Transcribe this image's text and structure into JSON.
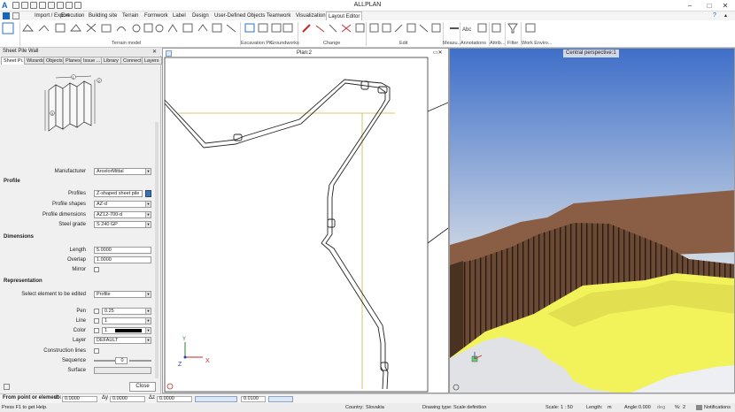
{
  "app": {
    "title": "ALLPLAN",
    "logo_letter": "A"
  },
  "window_controls": {
    "minimize": "–",
    "maximize": "□",
    "close": "✕"
  },
  "menu_tabs": [
    "Import / Export",
    "Execution",
    "Building site",
    "Terrain",
    "Formwork",
    "Label",
    "Design",
    "User-Defined Objects",
    "Teamwork",
    "Visualization",
    "Layout Editor"
  ],
  "menu_active": "Layout Editor",
  "ribbon_groups": [
    "Terrain model",
    "Excavation Pit",
    "Groundworks",
    "Change",
    "Edit",
    "Measu...",
    "Annotations",
    "Attrib...",
    "Filter",
    "Work Enviro..."
  ],
  "palette": {
    "title": "Sheet Pile Wall",
    "tabs": [
      "Sheet Pi...",
      "Wizards",
      "Objects",
      "Planes",
      "Issue ...",
      "Library",
      "Connect",
      "Layers"
    ],
    "manufacturer_label": "Manufacturer",
    "manufacturer_value": "ArcelorMittal",
    "profile_section": "Profile",
    "profiles_label": "Profiles",
    "profiles_value": "Z-shaped sheet pile",
    "profile_shapes_label": "Profile shapes",
    "profile_shapes_value": "AZ-d",
    "profile_dimensions_label": "Profile dimensions",
    "profile_dimensions_value": "AZ12-700-d",
    "steel_grade_label": "Steel grade",
    "steel_grade_value": "S 240 GP",
    "dimensions_section": "Dimensions",
    "length_label": "Length",
    "length_value": "5.0000",
    "overlap_label": "Overlap",
    "overlap_value": "1.0000",
    "mirror_label": "Mirror",
    "representation_section": "Representation",
    "select_element_label": "Select element to be edited",
    "select_element_value": "Profile",
    "pen_label": "Pen",
    "pen_value": "0.25",
    "line_label": "Line",
    "line_value": "1",
    "color_label": "Color",
    "color_value": "1",
    "layer_label": "Layer",
    "layer_value": "DEFAULT",
    "construction_lines_label": "Construction lines",
    "sequence_label": "Sequence",
    "sequence_value": "0",
    "surface_label": "Surface",
    "close_button": "Close",
    "diagram_labels": [
      "1",
      "2",
      "3"
    ]
  },
  "plan_view": {
    "title": "Plan:2",
    "axis_x": "X",
    "axis_y": "Y",
    "axis_z": "Z"
  },
  "perspective_view": {
    "title": "Central perspective:1"
  },
  "coord_bar": {
    "mode": "From point or element",
    "dx_label": "Δx",
    "dx_value": "0.0000",
    "dy_label": "Δy",
    "dy_value": "0.0000",
    "dz_label": "Δz",
    "dz_value": "0.0000",
    "step_value": "0.0100"
  },
  "status_bar": {
    "help": "Press F1 to get Help.",
    "country_label": "Country:",
    "country_value": "Slovakia",
    "drawing_type_label": "Drawing type:",
    "drawing_type_value": "Scale definition",
    "scale_label": "Scale:",
    "scale_value": "1 : 50",
    "length_label": "Length:",
    "length_value": "m",
    "angle_label": "Angle:",
    "angle_value": "0.000",
    "angle_unit": "deg",
    "percent_label": "%:",
    "percent_value": "2",
    "notifications": "Notifications"
  },
  "colors": {
    "accent_blue": "#1565c0",
    "sky_top": "#3f6fc9",
    "sky_bottom": "#d7dee7",
    "earth": "#6b4a35",
    "ground_fill": "#f2f25a"
  }
}
